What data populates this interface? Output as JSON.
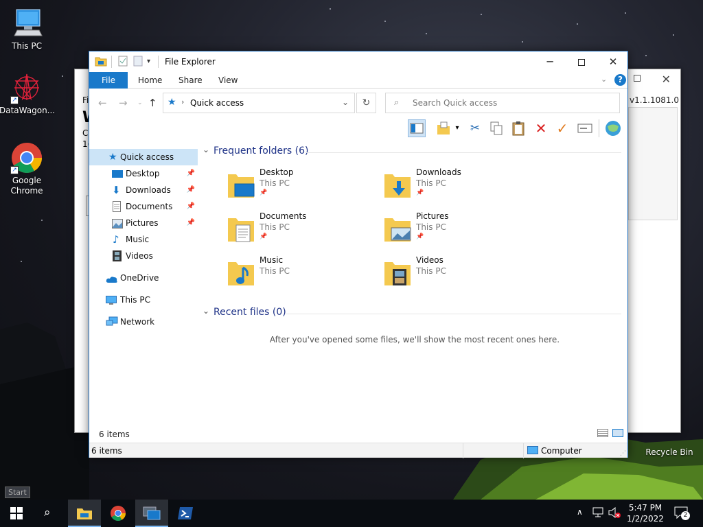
{
  "desktop": {
    "icons": [
      {
        "label": "This PC"
      },
      {
        "label": "DataWagon..."
      },
      {
        "label": "Google Chrome"
      },
      {
        "label": "Recycle Bin"
      }
    ]
  },
  "back_window": {
    "version": "v1.1.1081.0",
    "fragments": [
      "Fi",
      "W",
      "C:",
      "1("
    ]
  },
  "explorer": {
    "title": "File Explorer",
    "ribbon_tabs": {
      "file": "File",
      "home": "Home",
      "share": "Share",
      "view": "View"
    },
    "address": {
      "location": "Quick access"
    },
    "search": {
      "placeholder": "Search Quick access"
    },
    "nav": {
      "quick_access": "Quick access",
      "pinned": [
        {
          "label": "Desktop"
        },
        {
          "label": "Downloads"
        },
        {
          "label": "Documents"
        },
        {
          "label": "Pictures"
        },
        {
          "label": "Music"
        },
        {
          "label": "Videos"
        }
      ],
      "onedrive": "OneDrive",
      "this_pc": "This PC",
      "network": "Network"
    },
    "frequent": {
      "header": "Frequent folders (6)",
      "folders": [
        {
          "name": "Desktop",
          "location": "This PC",
          "pinned": true
        },
        {
          "name": "Downloads",
          "location": "This PC",
          "pinned": true
        },
        {
          "name": "Documents",
          "location": "This PC",
          "pinned": true
        },
        {
          "name": "Pictures",
          "location": "This PC",
          "pinned": true
        },
        {
          "name": "Music",
          "location": "This PC",
          "pinned": false
        },
        {
          "name": "Videos",
          "location": "This PC",
          "pinned": false
        }
      ]
    },
    "recent": {
      "header": "Recent files (0)",
      "empty_message": "After you've opened some files, we'll show the most recent ones here."
    },
    "status": {
      "items": "6 items",
      "items2": "6 items",
      "location": "Computer"
    }
  },
  "taskbar": {
    "start_tooltip": "Start",
    "clock_time": "5:47 PM",
    "clock_date": "1/2/2022",
    "notification_count": "2"
  },
  "colors": {
    "accent": "#1979ca",
    "selection": "#cce4f7",
    "group_header": "#1e3287",
    "folder": "#f4c94f"
  }
}
